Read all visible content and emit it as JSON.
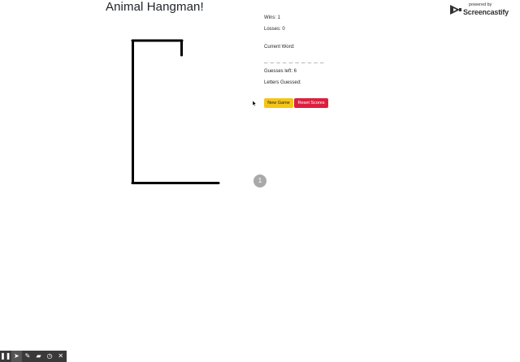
{
  "page": {
    "title": "Animal Hangman!"
  },
  "scoreboard": {
    "wins": "Wins: 1",
    "losses": "Losses: 0",
    "current_word_label": "Current Word:",
    "current_word_display": "_ _ _ _ _ _ _ _ _ _",
    "guesses_left": "Guesses left: 6",
    "letters_guessed": "Letters Guessed:"
  },
  "buttons": {
    "new_game": "New Game",
    "reset_scores": "Reset Scores"
  },
  "recording": {
    "step_badge": "1",
    "powered_by": "powered by",
    "brand": "Screencastify"
  },
  "toolbar": {
    "items": [
      {
        "icon": "pause-icon",
        "glyph": "❚❚"
      },
      {
        "icon": "cursor-icon",
        "glyph": "➤"
      },
      {
        "icon": "pen-icon",
        "glyph": "✎"
      },
      {
        "icon": "eraser-icon",
        "glyph": "▰"
      },
      {
        "icon": "timer-icon",
        "glyph": "◷"
      },
      {
        "icon": "close-icon",
        "glyph": "✕"
      }
    ]
  },
  "colors": {
    "new_game_bg": "#f5c518",
    "reset_scores_bg": "#dc1f3f",
    "toolbar_bg": "#3a3a3a",
    "badge_bg": "#a9a9a9"
  }
}
